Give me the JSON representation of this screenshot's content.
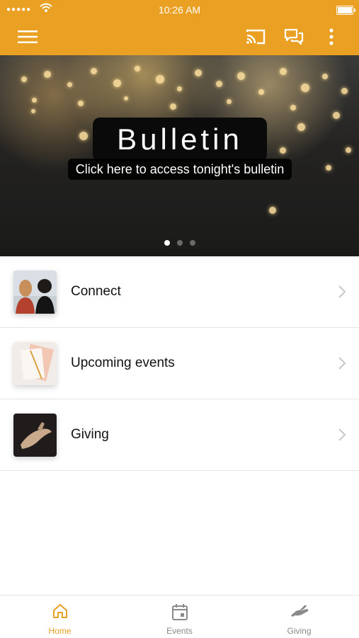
{
  "status_bar": {
    "time": "10:26 AM",
    "signal": "●●●●●"
  },
  "app_bar": {
    "menu_icon": "hamburger-menu-icon",
    "cast_icon": "cast-icon",
    "chat_icon": "chat-bubbles-icon",
    "more_icon": "more-vertical-icon",
    "color": "#e9a023"
  },
  "hero": {
    "title": "Bulletin",
    "subtitle": "Click here to access tonight's bulletin",
    "pages": 3,
    "active_page": 1
  },
  "menu": [
    {
      "label": "Connect"
    },
    {
      "label": "Upcoming events"
    },
    {
      "label": "Giving"
    }
  ],
  "tabs": [
    {
      "label": "Home",
      "icon": "home-icon",
      "active": true
    },
    {
      "label": "Events",
      "icon": "calendar-icon",
      "active": false
    },
    {
      "label": "Giving",
      "icon": "giving-hand-icon",
      "active": false
    }
  ],
  "colors": {
    "accent": "#e9a023",
    "tab_inactive": "#8a8a8a"
  }
}
